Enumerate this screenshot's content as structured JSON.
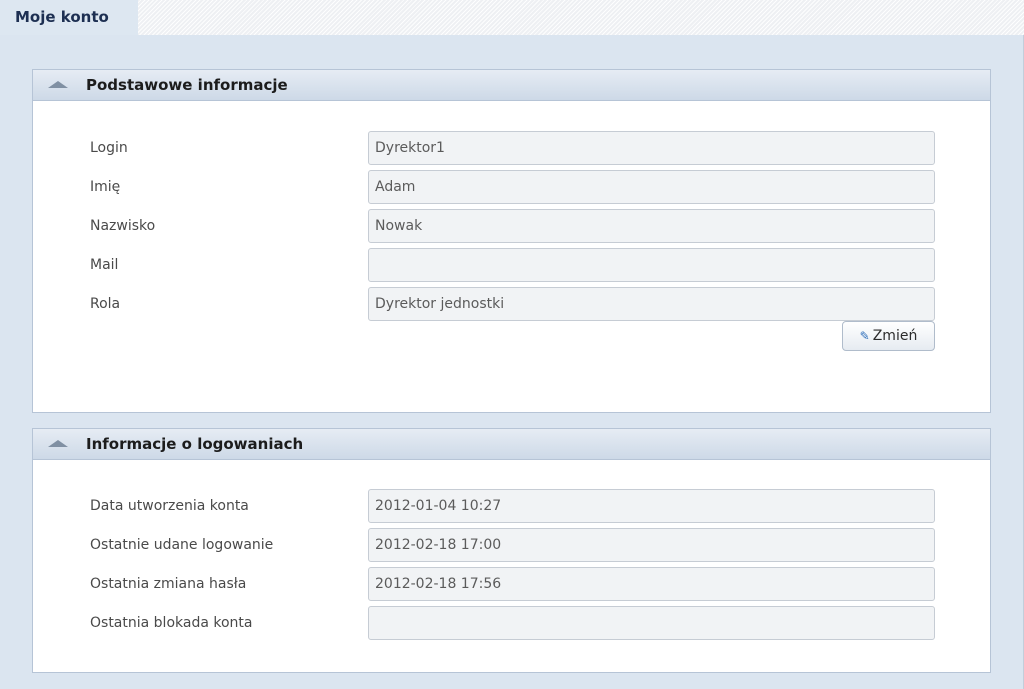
{
  "tab": {
    "label": "Moje konto"
  },
  "basic_panel": {
    "title": "Podstawowe informacje",
    "icon": "collapse-arrow-icon",
    "rows": [
      {
        "label": "Login",
        "value": "Dyrektor1"
      },
      {
        "label": "Imię",
        "value": "Adam"
      },
      {
        "label": "Nazwisko",
        "value": "Nowak"
      },
      {
        "label": "Mail",
        "value": ""
      },
      {
        "label": "Rola",
        "value": "Dyrektor jednostki"
      }
    ],
    "change_button": {
      "label": "Zmień",
      "icon": "pencil-icon"
    }
  },
  "login_panel": {
    "title": "Informacje o logowaniach",
    "icon": "collapse-arrow-icon",
    "rows": [
      {
        "label": "Data utworzenia konta",
        "value": "2012-01-04 10:27"
      },
      {
        "label": "Ostatnie udane logowanie",
        "value": "2012-02-18 17:00"
      },
      {
        "label": "Ostatnia zmiana hasła",
        "value": "2012-02-18 17:56"
      },
      {
        "label": "Ostatnia blokada konta",
        "value": ""
      }
    ]
  }
}
